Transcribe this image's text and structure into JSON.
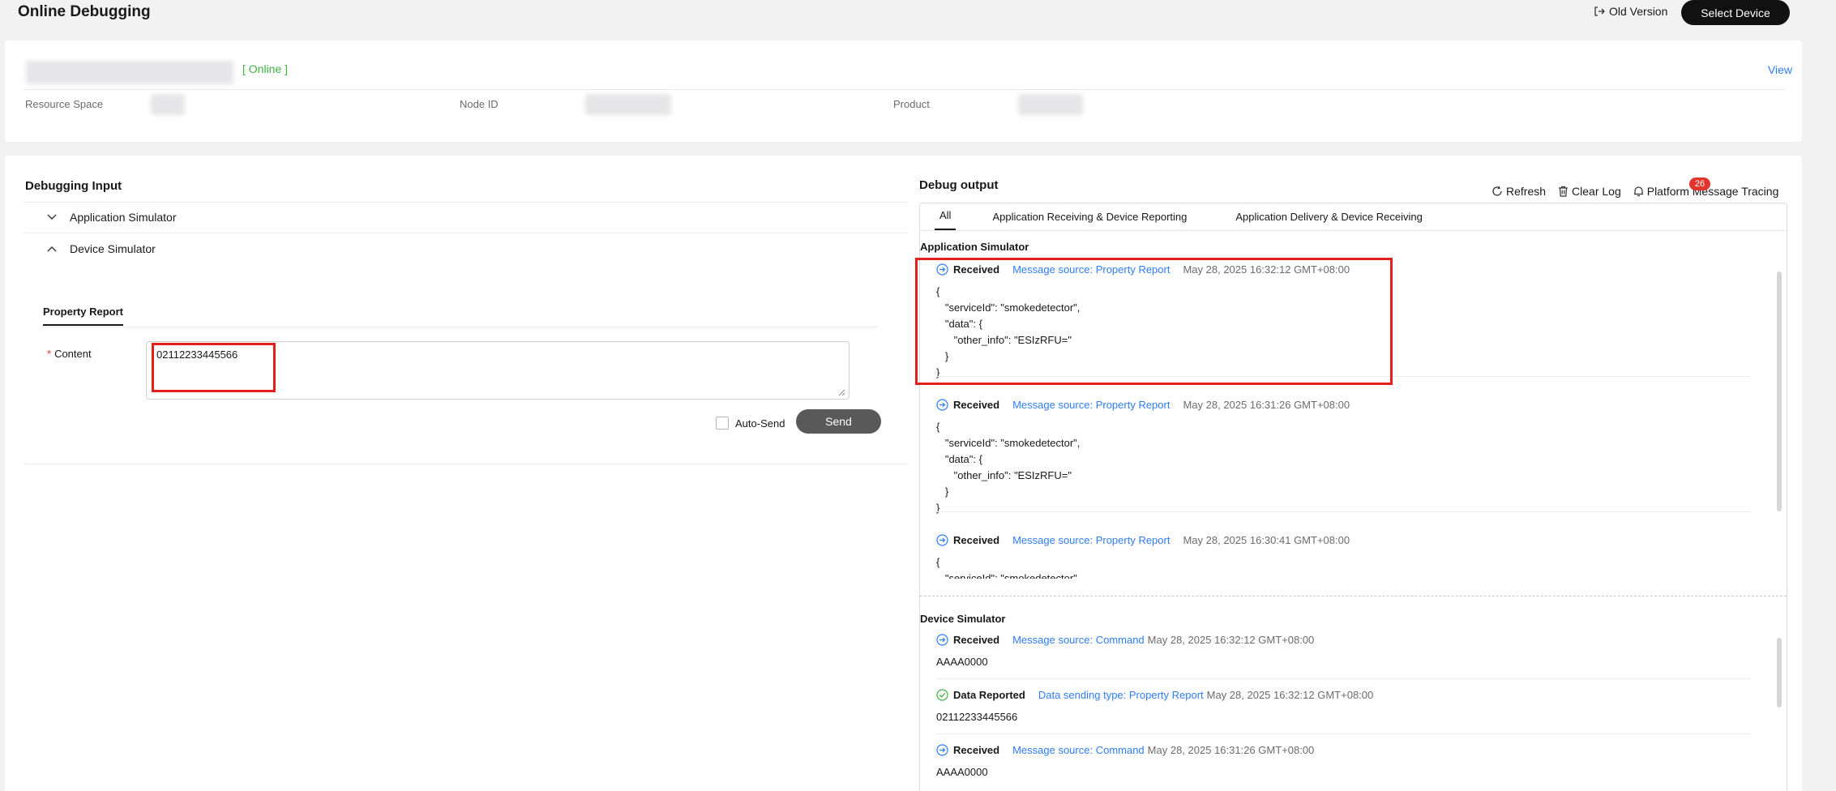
{
  "header": {
    "title": "Online Debugging",
    "old_version_label": "Old Version",
    "select_device_label": "Select Device"
  },
  "device": {
    "status": "[ Online ]",
    "view_label": "View",
    "fields": [
      {
        "label": "Resource Space"
      },
      {
        "label": "Node ID"
      },
      {
        "label": "Product"
      }
    ]
  },
  "input": {
    "title": "Debugging Input",
    "app_simulator_label": "Application Simulator",
    "device_simulator_label": "Device Simulator",
    "tab_label": "Property Report",
    "content_label": "Content",
    "content_value": "02112233445566",
    "auto_send_label": "Auto-Send",
    "send_label": "Send"
  },
  "output": {
    "title": "Debug output",
    "refresh_label": "Refresh",
    "clear_label": "Clear Log",
    "tracing_label": "Platform Message Tracing",
    "badge_count": "26",
    "tabs": [
      "All",
      "Application Receiving & Device Reporting",
      "Application Delivery & Device Receiving"
    ],
    "app_section_title": "Application Simulator",
    "app_messages": [
      {
        "kind": "Received",
        "source": "Message source: Property Report",
        "time": "May 28, 2025 16:32:12 GMT+08:00",
        "body": "{\n   \"serviceId\": \"smokedetector\",\n   \"data\": {\n      \"other_info\": \"ESIzRFU=\"\n   }\n}"
      },
      {
        "kind": "Received",
        "source": "Message source: Property Report",
        "time": "May 28, 2025 16:31:26 GMT+08:00",
        "body": "{\n   \"serviceId\": \"smokedetector\",\n   \"data\": {\n      \"other_info\": \"ESIzRFU=\"\n   }\n}"
      },
      {
        "kind": "Received",
        "source": "Message source: Property Report",
        "time": "May 28, 2025 16:30:41 GMT+08:00",
        "body": "{\n   \"serviceId\": \"smokedetector\","
      }
    ],
    "device_section_title": "Device Simulator",
    "device_messages": [
      {
        "kind": "Received",
        "source": "Message source: Command",
        "time": "May 28, 2025 16:32:12 GMT+08:00",
        "body": "AAAA0000"
      },
      {
        "kind": "Data Reported",
        "source": "Data sending type: Property Report",
        "time": "May 28, 2025 16:32:12 GMT+08:00",
        "body": "02112233445566"
      },
      {
        "kind": "Received",
        "source": "Message source: Command",
        "time": "May 28, 2025 16:31:26 GMT+08:00",
        "body": "AAAA0000"
      }
    ]
  },
  "colors": {
    "accent": "#2f7df6",
    "online": "#3eb33e",
    "highlight": "#e3201b",
    "badge": "#e2352c"
  }
}
